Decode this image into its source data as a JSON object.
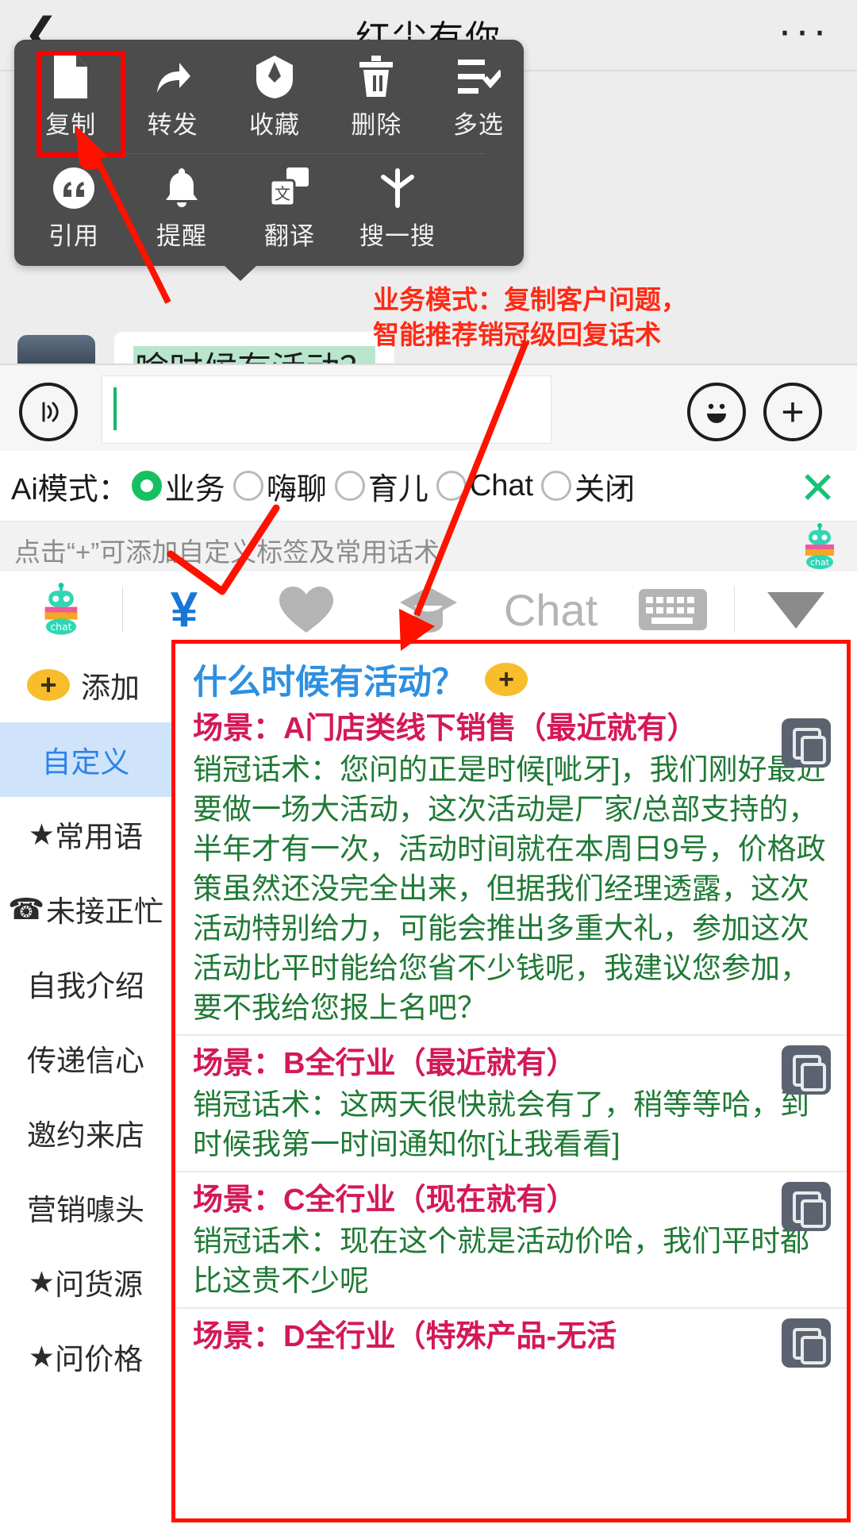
{
  "header": {
    "title": "红尘有你",
    "back_icon": "chevron-left-icon",
    "more_icon": "more-horizontal-icon"
  },
  "context_menu": {
    "row1": [
      {
        "label": "复制",
        "icon": "document-icon"
      },
      {
        "label": "转发",
        "icon": "forward-arrow-icon"
      },
      {
        "label": "收藏",
        "icon": "star-box-icon"
      },
      {
        "label": "删除",
        "icon": "trash-icon"
      },
      {
        "label": "多选",
        "icon": "checklist-icon"
      }
    ],
    "row2": [
      {
        "label": "引用",
        "icon": "quote-icon"
      },
      {
        "label": "提醒",
        "icon": "bell-icon"
      },
      {
        "label": "翻译",
        "icon": "translate-icon"
      },
      {
        "label": "搜一搜",
        "icon": "search-star-icon"
      }
    ]
  },
  "message": {
    "text": "啥时候有活动？",
    "avatar": "contact-avatar"
  },
  "annotation": {
    "line1": "业务模式：复制客户问题，",
    "line2": "智能推荐销冠级回复话术",
    "color": "#ff2a15"
  },
  "input_bar": {
    "voice_icon": "voice-wave-icon",
    "value": "",
    "placeholder": "",
    "emoji_icon": "smiley-icon",
    "plus_icon": "plus-icon"
  },
  "ai_mode": {
    "label": "Ai模式：",
    "options": [
      {
        "label": "业务",
        "selected": true
      },
      {
        "label": "嗨聊",
        "selected": false
      },
      {
        "label": "育儿",
        "selected": false
      },
      {
        "label": "Chat",
        "selected": false
      },
      {
        "label": "关闭",
        "selected": false
      }
    ],
    "close_icon": "close-x-icon",
    "accent": "#16c060",
    "close_color": "#18c174"
  },
  "hint_bar": {
    "text": "点击“+”可添加自定义标签及常用话术",
    "bot_icon": "chat-robot-icon"
  },
  "tool_row": {
    "items": [
      {
        "icon": "chat-robot-icon",
        "label": ""
      },
      {
        "icon": "yuan-currency-icon",
        "label": "¥"
      },
      {
        "icon": "heart-icon",
        "label": ""
      },
      {
        "icon": "graduation-cap-icon",
        "label": ""
      },
      {
        "icon": "chat-text-icon",
        "label": "Chat"
      },
      {
        "icon": "keyboard-icon",
        "label": ""
      },
      {
        "icon": "triangle-down-icon",
        "label": ""
      }
    ]
  },
  "sidebar": {
    "add_label": "添加",
    "add_icon": "plus-circle-icon",
    "items": [
      {
        "label": "自定义",
        "active": true,
        "star": false
      },
      {
        "label": "常用语",
        "active": false,
        "star": true
      },
      {
        "label": "未接正忙",
        "active": false,
        "star": false,
        "icon": "telephone-icon"
      },
      {
        "label": "自我介绍",
        "active": false,
        "star": false
      },
      {
        "label": "传递信心",
        "active": false,
        "star": false
      },
      {
        "label": "邀约来店",
        "active": false,
        "star": false
      },
      {
        "label": "营销噱头",
        "active": false,
        "star": false
      },
      {
        "label": "问货源",
        "active": false,
        "star": true
      },
      {
        "label": "问价格",
        "active": false,
        "star": true
      }
    ]
  },
  "scripts": {
    "question": "什么时候有活动？",
    "add_icon": "plus-circle-icon",
    "copy_icon": "copy-icon",
    "scene_label": "场景：",
    "reply_label": "销冠话术：",
    "blocks": [
      {
        "scene": "场景：A门店类线下销售（最近就有）",
        "reply": "销冠话术：您问的正是时候[呲牙]，我们刚好最近要做一场大活动，这次活动是厂家/总部支持的，半年才有一次，活动时间就在本周日9号，价格政策虽然还没完全出来，但据我们经理透露，这次活动特别给力，可能会推出多重大礼，参加这次活动比平时能给您省不少钱呢，我建议您参加，要不我给您报上名吧？"
      },
      {
        "scene": "场景：B全行业（最近就有）",
        "reply": "销冠话术：这两天很快就会有了，稍等等哈，到时候我第一时间通知你[让我看看]"
      },
      {
        "scene": "场景：C全行业（现在就有）",
        "reply": "销冠话术：现在这个就是活动价哈，我们平时都比这贵不少呢"
      },
      {
        "scene": "场景：D全行业（特殊产品-无活",
        "reply": ""
      }
    ]
  }
}
